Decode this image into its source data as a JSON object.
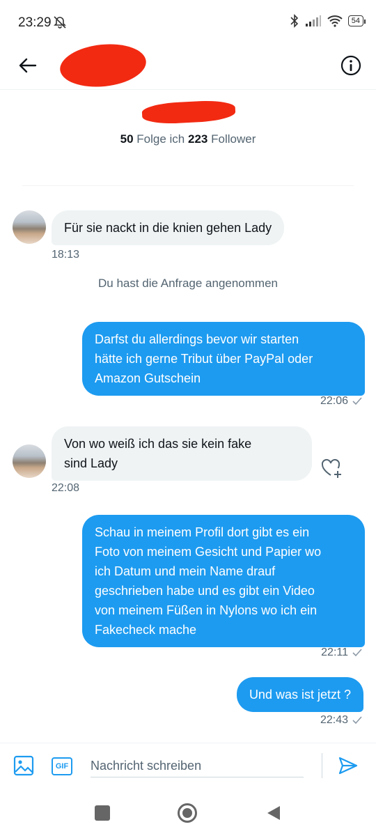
{
  "status_bar": {
    "time": "23:29",
    "battery": "54",
    "icons": [
      "alarm-off-icon",
      "bluetooth-icon",
      "signal-icon",
      "wifi-icon",
      "battery-icon"
    ]
  },
  "header": {
    "back_icon": "arrow-left-icon",
    "info_icon": "info-icon"
  },
  "profile": {
    "following_count": "50",
    "following_label": "Folge ich",
    "followers_count": "223",
    "followers_label": "Follower"
  },
  "messages": [
    {
      "direction": "in",
      "text": "Für sie nackt in die knien gehen Lady",
      "time": "18:13"
    },
    {
      "direction": "system",
      "text": "Du hast die Anfrage angenommen"
    },
    {
      "direction": "out",
      "lines": [
        "Darfst du allerdings bevor wir starten",
        "hätte ich gerne Tribut über PayPal oder",
        "Amazon Gutschein"
      ],
      "time": "22:06"
    },
    {
      "direction": "in",
      "lines": [
        "Von wo weiß ich das sie kein fake",
        "sind Lady"
      ],
      "time": "22:08"
    },
    {
      "direction": "out",
      "lines": [
        "Schau in meinem Profil dort gibt es ein",
        "Foto von meinem Gesicht und Papier wo",
        "ich Datum und mein Name drauf",
        "geschrieben habe und es gibt ein Video",
        "von meinem Füßen in Nylons wo ich ein",
        "Fakecheck mache"
      ],
      "time": "22:11"
    },
    {
      "direction": "out",
      "text": "Und was ist jetzt ?",
      "time": "22:43"
    }
  ],
  "composer": {
    "placeholder": "Nachricht schreiben",
    "gif_label": "GIF"
  },
  "colors": {
    "accent": "#1d9bf0",
    "incoming_bubble": "#eff3f4",
    "secondary_text": "#536471",
    "redaction": "#f22a12"
  }
}
